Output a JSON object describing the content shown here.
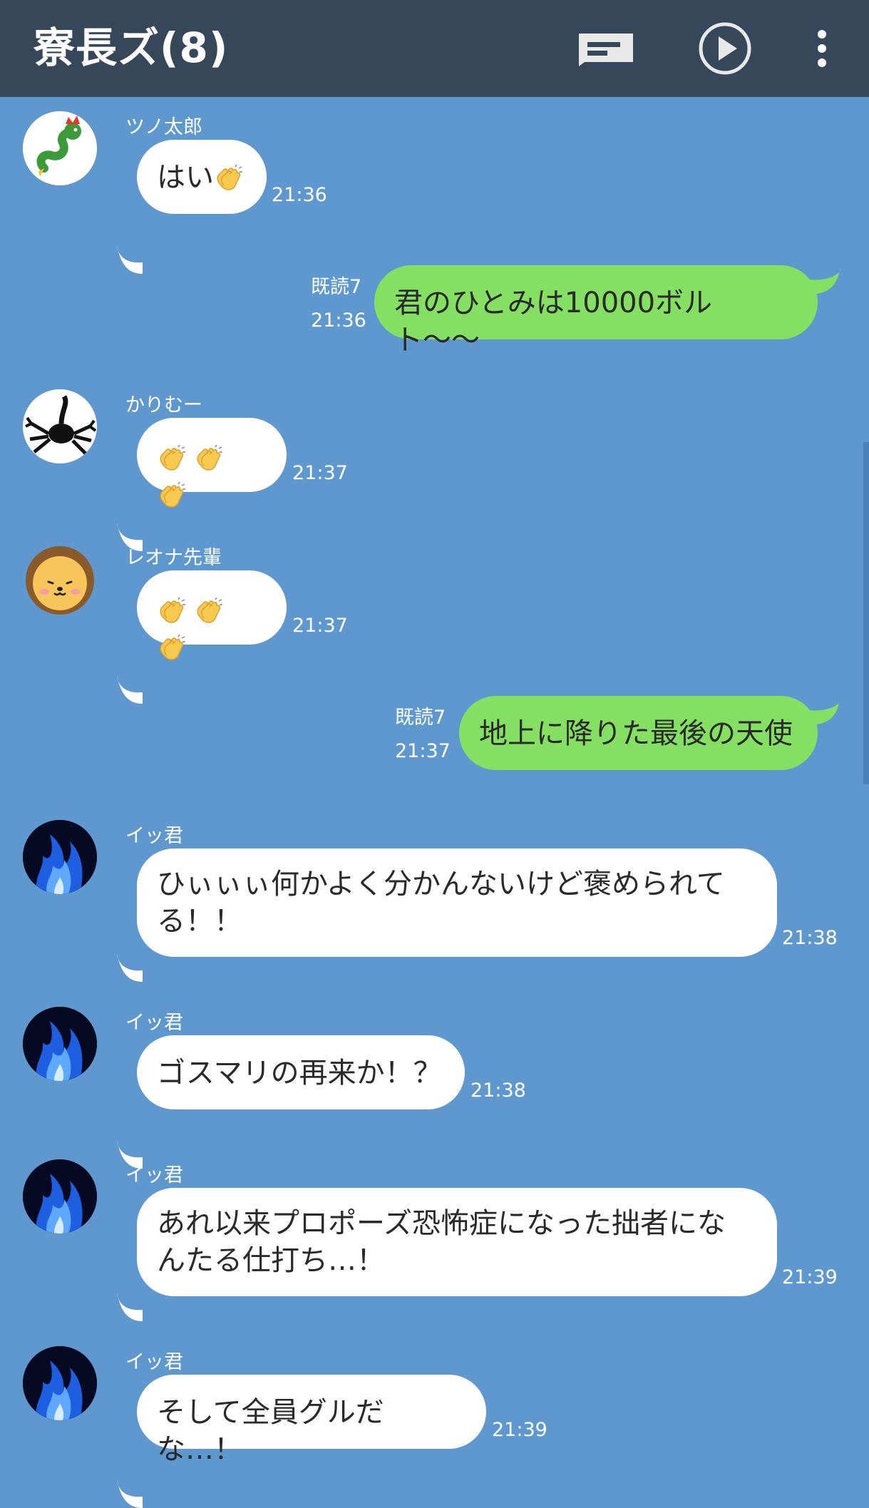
{
  "header": {
    "title": "寮長ズ(8)",
    "icons": [
      "note-icon",
      "play-icon",
      "more-vert-icon"
    ]
  },
  "messages": [
    {
      "type": "in",
      "sender": "ツノ太郎",
      "avatar": "dragon-avatar",
      "text": "はい",
      "emoji": [
        "clap-emoji"
      ],
      "time": "21:36"
    },
    {
      "type": "out",
      "read": "既読7",
      "text": "君のひとみは10000ボルト〜〜",
      "time": "21:36"
    },
    {
      "type": "in",
      "sender": "かりむー",
      "avatar": "scorpion-avatar",
      "emoji": [
        "clap-emoji",
        "clap-emoji",
        "clap-emoji"
      ],
      "time": "21:37"
    },
    {
      "type": "in",
      "sender": "レオナ先輩",
      "avatar": "lion-avatar",
      "emoji": [
        "clap-emoji",
        "clap-emoji",
        "clap-emoji"
      ],
      "time": "21:37"
    },
    {
      "type": "out",
      "read": "既読7",
      "text": "地上に降りた最後の天使",
      "time": "21:37"
    },
    {
      "type": "in",
      "sender": "イッ君",
      "avatar": "blue-flame-avatar",
      "lines": [
        "ひぃぃぃ何かよく分かんないけど褒められて",
        "る！！"
      ],
      "time": "21:38"
    },
    {
      "type": "in",
      "sender": "イッ君",
      "avatar": "blue-flame-avatar",
      "text": "ゴスマリの再来か！？",
      "time": "21:38"
    },
    {
      "type": "in",
      "sender": "イッ君",
      "avatar": "blue-flame-avatar",
      "lines": [
        "あれ以来プロポーズ恐怖症になった拙者にな",
        "んたる仕打ち…！"
      ],
      "time": "21:39"
    },
    {
      "type": "in",
      "sender": "イッ君",
      "avatar": "blue-flame-avatar",
      "text": "そして全員グルだな…！",
      "time": "21:39"
    }
  ],
  "colors": {
    "background": "#5f98cf",
    "header": "#36475a",
    "incoming_bubble": "#ffffff",
    "outgoing_bubble": "#85df62"
  }
}
